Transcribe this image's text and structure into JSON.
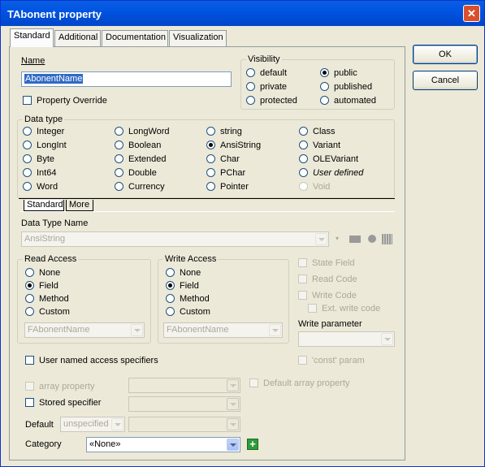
{
  "title": "TAbonent property",
  "buttons": {
    "ok": "OK",
    "cancel": "Cancel"
  },
  "tabs": [
    "Standard",
    "Additional",
    "Documentation",
    "Visualization"
  ],
  "name": {
    "label": "Name",
    "value": "AbonentName"
  },
  "property_override": "Property Override",
  "visibility": {
    "label": "Visibility",
    "options": [
      "default",
      "public",
      "private",
      "published",
      "protected",
      "automated"
    ],
    "selected": "public"
  },
  "data_type": {
    "label": "Data type",
    "options": [
      "Integer",
      "LongWord",
      "string",
      "Class",
      "LongInt",
      "Boolean",
      "AnsiString",
      "Variant",
      "Byte",
      "Extended",
      "Char",
      "OLEVariant",
      "Int64",
      "Double",
      "PChar",
      "User defined",
      "Word",
      "Currency",
      "Pointer",
      "Void"
    ],
    "selected": "AnsiString"
  },
  "subtabs": [
    "Standard",
    "More"
  ],
  "data_type_name": {
    "label": "Data Type Name",
    "value": "AnsiString"
  },
  "read_access": {
    "label": "Read Access",
    "options": [
      "None",
      "Field",
      "Method",
      "Custom"
    ],
    "selected": "Field",
    "combo": "FAbonentName"
  },
  "write_access": {
    "label": "Write Access",
    "options": [
      "None",
      "Field",
      "Method",
      "Custom"
    ],
    "selected": "Field",
    "combo": "FAbonentName"
  },
  "right_checks": {
    "state_field": "State Field",
    "read_code": "Read Code",
    "write_code": "Write Code",
    "ext_write_code": "Ext. write code"
  },
  "write_parameter": "Write parameter",
  "const_param": "'const' param",
  "user_named": "User named access specifiers",
  "array_property": "array property",
  "default_array_property": "Default array property",
  "stored_specifier": "Stored specifier",
  "default": {
    "label": "Default",
    "value": "unspecified"
  },
  "category": {
    "label": "Category",
    "value": "«None»"
  }
}
